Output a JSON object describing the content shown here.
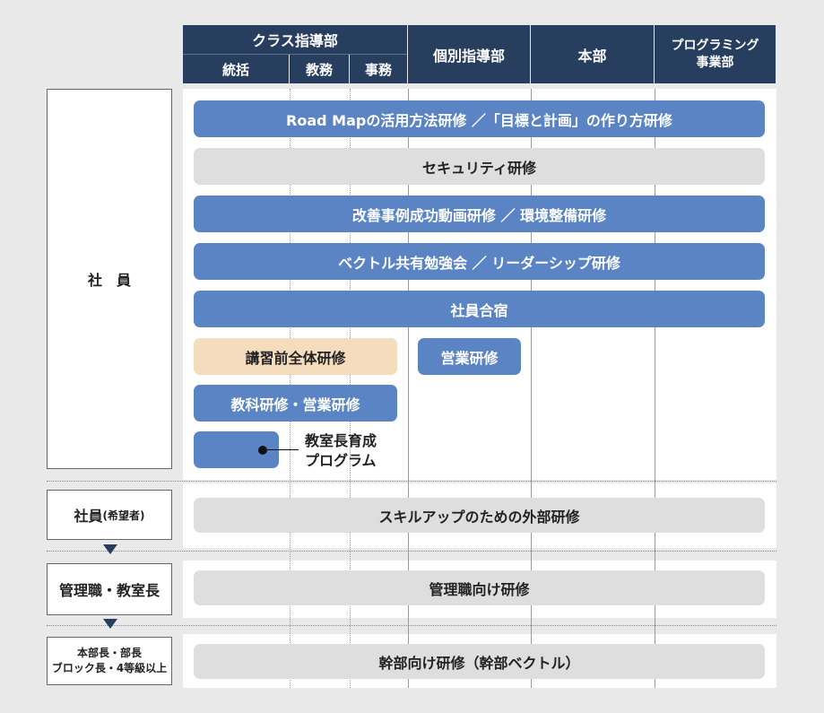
{
  "header": {
    "class_dept": "クラス指導部",
    "class_sub": [
      "統括",
      "教務",
      "事務"
    ],
    "individual": "個別指導部",
    "hq": "本部",
    "programming_line1": "プログラミング",
    "programming_line2": "事業部"
  },
  "rows": {
    "employee": "社　員",
    "employee_wish_main": "社員",
    "employee_wish_sub": "(希望者)",
    "manager": "管理職・教室長",
    "exec_line1": "本部長・部長",
    "exec_line2": "ブロック長・4等級以上"
  },
  "bars": {
    "roadmap": "Road Mapの活用方法研修 ／「目標と計画」の作り方研修",
    "security": "セキュリティ研修",
    "kaizen": "改善事例成功動画研修 ／ 環境整備研修",
    "vector": "ベクトル共有勉強会 ／ リーダーシップ研修",
    "camp": "社員合宿",
    "pre_lecture": "講習前全体研修",
    "sales_individual": "営業研修",
    "subject_sales": "教科研修・営業研修",
    "skillup": "スキルアップのための外部研修",
    "manager_training": "管理職向け研修",
    "exec_training": "幹部向け研修（幹部ベクトル）"
  },
  "callout": {
    "line1": "教室長育成",
    "line2": "プログラム"
  },
  "colors": {
    "header_navy": "#273e5e",
    "bar_blue": "#5b84c4",
    "bar_gray": "#dedede",
    "bar_beige": "#f5dcbd",
    "background": "#e9e9e9"
  }
}
